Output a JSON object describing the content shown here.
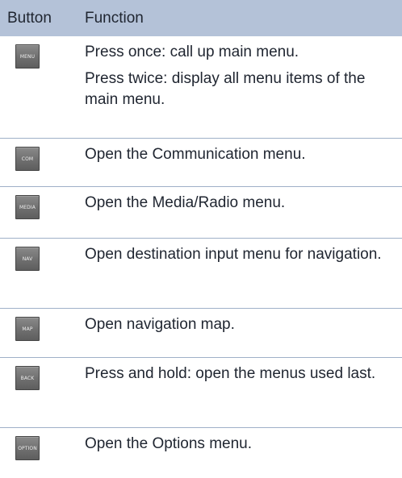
{
  "header": {
    "button": "Button",
    "function": "Function"
  },
  "rows": [
    {
      "key_label": "MENU",
      "lines": [
        "Press once: call up main menu.",
        "Press twice: display all menu items of the main menu."
      ]
    },
    {
      "key_label": "COM",
      "lines": [
        "Open the Communication menu."
      ]
    },
    {
      "key_label": "MEDIA",
      "lines": [
        "Open the Media/Radio menu."
      ]
    },
    {
      "key_label": "NAV",
      "lines": [
        "Open destination input menu for navigation."
      ]
    },
    {
      "key_label": "MAP",
      "lines": [
        "Open navigation map."
      ]
    },
    {
      "key_label": "BACK",
      "lines": [
        "Press and hold: open the menus used last."
      ]
    },
    {
      "key_label": "OPTION",
      "lines": [
        "Open the Options menu."
      ]
    }
  ],
  "colors": {
    "header_bg": "#b4c2d8",
    "divider": "#9fb0c8",
    "key_face": "#6f6f6f",
    "text": "#1f2530"
  }
}
